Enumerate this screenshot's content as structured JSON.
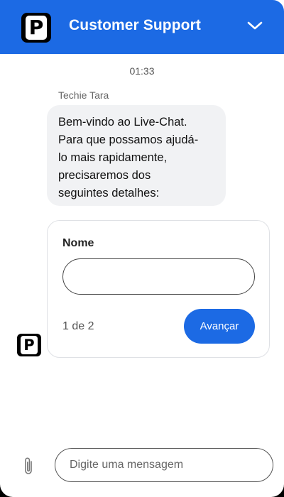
{
  "header": {
    "title": "Customer Support",
    "logo_icon": "brand-p-logo-icon",
    "collapse_icon": "chevron-down-icon",
    "background_color": "#1c6ae4"
  },
  "conversation": {
    "timestamp": "01:33",
    "sender_name": "Techie Tara",
    "message_lines": [
      "Bem-vindo ao Live-Chat.",
      "Para que possamos ajudá-",
      "lo mais rapidamente,",
      "precisaremos dos",
      "seguintes detalhes:"
    ]
  },
  "form": {
    "field_label": "Nome",
    "field_value": "",
    "step_text": "1 de 2",
    "next_label": "Avançar",
    "button_color": "#1c6ae4"
  },
  "composer": {
    "placeholder": "Digite uma mensagem",
    "attach_icon": "paperclip-icon"
  }
}
